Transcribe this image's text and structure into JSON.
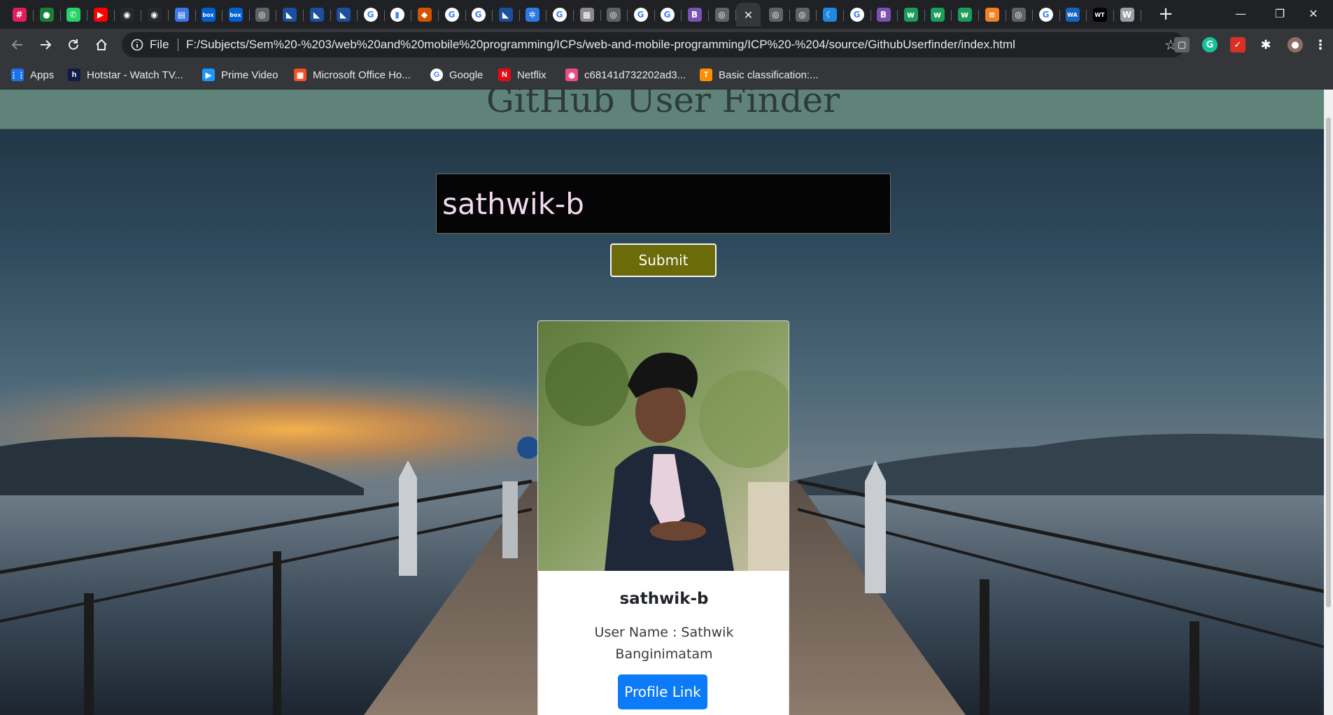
{
  "tabs": [
    {
      "icon": "slack-icon",
      "color": "#e01e5a",
      "glyph": "#"
    },
    {
      "icon": "grammarly-green-icon",
      "color": "#1a7f37",
      "glyph": "●"
    },
    {
      "icon": "whatsapp-icon",
      "color": "#25d366",
      "glyph": "✆"
    },
    {
      "icon": "youtube-icon",
      "color": "#ff0000",
      "glyph": "▶"
    },
    {
      "icon": "github-icon",
      "color": "#24292e",
      "glyph": "◉"
    },
    {
      "icon": "github-icon",
      "color": "#24292e",
      "glyph": "◉"
    },
    {
      "icon": "document-chart-icon",
      "color": "#3b78e7",
      "glyph": "▤"
    },
    {
      "icon": "box-icon",
      "color": "#0061d5",
      "glyph": "box"
    },
    {
      "icon": "box-icon",
      "color": "#0061d5",
      "glyph": "box"
    },
    {
      "icon": "globe-icon",
      "color": "#5f6368",
      "glyph": "◎"
    },
    {
      "icon": "university-icon",
      "color": "#1c4f9c",
      "glyph": "◣"
    },
    {
      "icon": "university-icon",
      "color": "#1c4f9c",
      "glyph": "◣"
    },
    {
      "icon": "university-icon",
      "color": "#1c4f9c",
      "glyph": "◣"
    },
    {
      "icon": "google-icon",
      "color": "#ffffff",
      "glyph": "G"
    },
    {
      "icon": "docs-icon",
      "color": "#ffffff",
      "glyph": "▮"
    },
    {
      "icon": "shield-icon",
      "color": "#d35400",
      "glyph": "◆"
    },
    {
      "icon": "google-icon",
      "color": "#ffffff",
      "glyph": "G"
    },
    {
      "icon": "google-icon",
      "color": "#ffffff",
      "glyph": "G"
    },
    {
      "icon": "university-icon",
      "color": "#1c4f9c",
      "glyph": "◣"
    },
    {
      "icon": "snowflake-icon",
      "color": "#2c7be5",
      "glyph": "✲"
    },
    {
      "icon": "google-icon",
      "color": "#ffffff",
      "glyph": "G"
    },
    {
      "icon": "image-icon",
      "color": "#8a8a8a",
      "glyph": "▦"
    },
    {
      "icon": "globe-icon",
      "color": "#5f6368",
      "glyph": "◎"
    },
    {
      "icon": "google-icon",
      "color": "#ffffff",
      "glyph": "G"
    },
    {
      "icon": "google-icon",
      "color": "#ffffff",
      "glyph": "G"
    },
    {
      "icon": "bootstrap-icon",
      "color": "#7952b3",
      "glyph": "B"
    },
    {
      "icon": "globe-icon",
      "color": "#5f6368",
      "glyph": "◎"
    },
    {
      "icon": "close-icon",
      "color": "#35363a",
      "glyph": "✕",
      "active": true
    },
    {
      "icon": "globe-icon",
      "color": "#5f6368",
      "glyph": "◎"
    },
    {
      "icon": "globe-icon",
      "color": "#5f6368",
      "glyph": "◎"
    },
    {
      "icon": "moon-icon",
      "color": "#1e88e5",
      "glyph": "☾"
    },
    {
      "icon": "google-icon",
      "color": "#ffffff",
      "glyph": "G"
    },
    {
      "icon": "bootstrap-icon",
      "color": "#7952b3",
      "glyph": "B"
    },
    {
      "icon": "w-icon",
      "color": "#1b9e5a",
      "glyph": "w"
    },
    {
      "icon": "w-icon",
      "color": "#1b9e5a",
      "glyph": "w"
    },
    {
      "icon": "w-icon",
      "color": "#1b9e5a",
      "glyph": "w"
    },
    {
      "icon": "stackoverflow-icon",
      "color": "#f48024",
      "glyph": "≡"
    },
    {
      "icon": "globe-icon",
      "color": "#5f6368",
      "glyph": "◎"
    },
    {
      "icon": "google-icon",
      "color": "#ffffff",
      "glyph": "G"
    },
    {
      "icon": "wa-icon",
      "color": "#1565c0",
      "glyph": "WA"
    },
    {
      "icon": "wt-icon",
      "color": "#000000",
      "glyph": "WT"
    },
    {
      "icon": "w-script-icon",
      "color": "#9aa0a6",
      "glyph": "W"
    }
  ],
  "address_bar": {
    "scheme_label": "File",
    "url": "F:/Subjects/Sem%20-%203/web%20and%20mobile%20programming/ICPs/web-and-mobile-programming/ICP%20-%204/source/GithubUserfinder/index.html"
  },
  "bookmarks": [
    {
      "label": "Apps",
      "icon": "apps-grid-icon",
      "color": "#1a73e8",
      "glyph": "⋮⋮"
    },
    {
      "label": "Hotstar - Watch TV...",
      "icon": "hotstar-icon",
      "color": "#0f1c48",
      "glyph": "h"
    },
    {
      "label": "Prime Video",
      "icon": "prime-video-icon",
      "color": "#1a98ff",
      "glyph": "▶"
    },
    {
      "label": "Microsoft Office Ho...",
      "icon": "microsoft-icon",
      "color": "#f25022",
      "glyph": "▦"
    },
    {
      "label": "Google",
      "icon": "google-icon",
      "color": "#ffffff",
      "glyph": "G"
    },
    {
      "label": "Netflix",
      "icon": "netflix-icon",
      "color": "#e50914",
      "glyph": "N"
    },
    {
      "label": "c68141d732202ad3...",
      "icon": "dribbble-icon",
      "color": "#ea4c89",
      "glyph": "◉"
    },
    {
      "label": "Basic classification:...",
      "icon": "tensorflow-icon",
      "color": "#ff8f00",
      "glyph": "T"
    }
  ],
  "page": {
    "title": "GitHub User Finder",
    "search_value": "sathwik-b",
    "submit_label": "Submit",
    "card": {
      "name": "sathwik-b",
      "description": "User Name : Sathwik Banginimatam",
      "button_label": "Profile Link"
    }
  },
  "window_controls": {
    "minimize": "—",
    "restore": "❐",
    "close": "✕"
  }
}
